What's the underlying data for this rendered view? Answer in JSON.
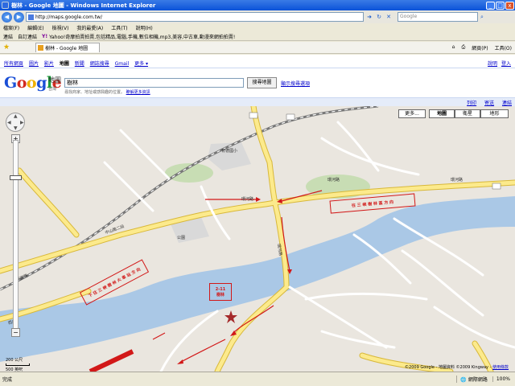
{
  "window": {
    "title": "樹林 - Google 地圖 - Windows Internet Explorer",
    "minimize": "_",
    "maximize": "□",
    "close": "x"
  },
  "address_bar": {
    "url": "http://maps.google.com.tw/",
    "search_placeholder": "Google"
  },
  "menu": {
    "items": [
      "檔案(F)",
      "編輯(E)",
      "檢視(V)",
      "我的最愛(A)",
      "工具(T)",
      "說明(H)"
    ]
  },
  "links_bar": {
    "label": "連結",
    "items": [
      "自訂連結",
      "Yahoo!奇摩拍賣拍賣,包括精品,電腦,手機,數位相機,mp3,美容,中古車,動漫來網拍拍賣!"
    ]
  },
  "tab": {
    "title": "樹林 - Google 地圖",
    "commands": [
      "網頁(P)",
      "工具(O)"
    ]
  },
  "google_nav": {
    "items": [
      "所有網頁",
      "圖片",
      "影片",
      "地圖",
      "新聞",
      "網誌搜尋",
      "Gmail",
      "更多 ▾"
    ],
    "current": "地圖",
    "right": [
      "說明",
      "登入"
    ]
  },
  "logo": {
    "letters": [
      "G",
      "o",
      "o",
      "g",
      "l",
      "e"
    ],
    "subtitle": "地圖",
    "region": "台灣"
  },
  "search": {
    "query": "樹林",
    "button": "搜尋地圖",
    "options": "顯示搜尋選項",
    "hint": "尋找商家、地址或感興趣的位置。",
    "hint_link": "瞭解更多資訊"
  },
  "map_tools": {
    "items": [
      "列印",
      "寄送",
      "連結"
    ]
  },
  "map_types": {
    "more": "更多...",
    "map": "地圖",
    "satellite": "衛星",
    "terrain": "地形",
    "active": "地圖"
  },
  "map_labels": {
    "road_huanhe_1": "環河路",
    "road_huanhe_2": "環河路",
    "road_huanhe_3": "環河路",
    "road_huanhe_4": "環河路",
    "road_zhongshan": "中山路二段",
    "road_xishan": "西園路",
    "road_xichuan": "西川",
    "park": "公園",
    "school": "育德國小"
  },
  "route_labels": {
    "label1": "下 往 三 峽 樹 林 火 車 站 方 向",
    "label2": "往 三 峽 樹 林 區 方 向",
    "label3_line1": "2-11",
    "label3_line2": "樹林"
  },
  "scale": {
    "metric": "200 公尺",
    "imperial": "500 英呎"
  },
  "copyright": {
    "text": "©2009 Google - 地圖資料 ©2009 Kingway - ",
    "terms": "使用條款"
  },
  "status": {
    "left": "完成",
    "zone": "網際網路",
    "zoom": "100%"
  }
}
